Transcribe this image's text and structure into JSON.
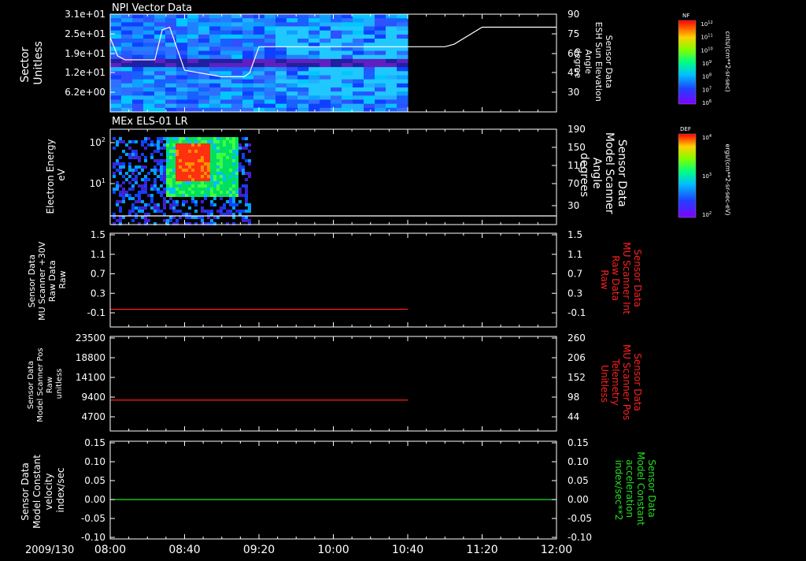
{
  "date_label": "2009/130",
  "time_ticks": [
    "08:00",
    "08:40",
    "09:20",
    "10:00",
    "10:40",
    "11:20",
    "12:00"
  ],
  "panels": [
    {
      "title": "NPI Vector Data",
      "left_label": [
        "Sector",
        "Unitless"
      ],
      "right_label": [
        "Sensor Data",
        "ESH Sun Elevation",
        "Angle",
        "degree"
      ],
      "left_ticks": [
        "3.1e+01",
        "2.5e+01",
        "1.9e+01",
        "1.2e+01",
        "6.2e+00"
      ],
      "right_ticks": [
        "90",
        "75",
        "60",
        "45",
        "30"
      ],
      "colorbar": {
        "label": "NF",
        "unit": "cnts/(cm**2-sr-sec)",
        "ticks": [
          "10^12",
          "10^11",
          "10^10",
          "10^9",
          "10^8",
          "10^7",
          "10^6"
        ]
      }
    },
    {
      "title": "MEx ELS-01 LR",
      "left_label": [
        "Electron Energy",
        "eV"
      ],
      "right_label": [
        "Sensor Data",
        "Model Scanner",
        "Angle",
        "degrees"
      ],
      "left_ticks": [
        "10^2",
        "10^1"
      ],
      "right_ticks": [
        "190",
        "150",
        "110",
        "70",
        "30"
      ],
      "colorbar": {
        "label": "DEF",
        "unit": "ergs/(cm**2-sr-sec-eV)",
        "ticks": [
          "10^4",
          "10^3",
          "10^2"
        ]
      }
    },
    {
      "left_label": [
        "Sensor Data",
        "MU Scanner +30V",
        "Raw Data",
        "Raw"
      ],
      "right_label": [
        "Sensor Data",
        "MU Scanner Int",
        "Raw Data",
        "Raw"
      ],
      "left_ticks": [
        "1.5",
        "1.1",
        "0.7",
        "0.3",
        "-0.1"
      ],
      "right_ticks": [
        "1.5",
        "1.1",
        "0.7",
        "0.3",
        "-0.1"
      ]
    },
    {
      "left_label": [
        "Sensor Data",
        "Model Scanner Pos",
        "Raw",
        "unitless"
      ],
      "right_label": [
        "Sensor Data",
        "MU Scanner Pos",
        "Telemetry",
        "Unitless"
      ],
      "left_ticks": [
        "23500",
        "18800",
        "14100",
        "9400",
        "4700"
      ],
      "right_ticks": [
        "260",
        "206",
        "152",
        "98",
        "44"
      ]
    },
    {
      "left_label": [
        "Sensor Data",
        "Model Constant",
        "velocity",
        "index/sec"
      ],
      "right_label": [
        "Sensor Data",
        "Model Constant",
        "acceleration",
        "index/sec**2"
      ],
      "left_ticks": [
        "0.15",
        "0.10",
        "0.05",
        "0.00",
        "-0.05",
        "-0.10"
      ],
      "right_ticks": [
        "0.15",
        "0.10",
        "0.05",
        "0.00",
        "-0.05",
        "-0.10"
      ]
    }
  ],
  "colors": {
    "red_trace": "#ff2020",
    "green_trace": "#20e020",
    "white": "#ffffff"
  },
  "chart_data": [
    {
      "type": "heatmap",
      "title": "NPI Vector Data",
      "ylabel": "Sector Unitless",
      "x_range": [
        "08:00",
        "12:00"
      ],
      "data_end": "10:40",
      "overlay_line": {
        "name": "Sensor Data ESH Sun Elevation Angle",
        "unit": "degree",
        "x": [
          "08:00",
          "08:04",
          "08:08",
          "08:24",
          "08:28",
          "08:32",
          "08:40",
          "09:00",
          "09:12",
          "09:15",
          "09:20",
          "10:00",
          "10:40",
          "11:00",
          "11:05",
          "11:20",
          "12:00"
        ],
        "y": [
          72,
          58,
          55,
          55,
          78,
          80,
          47,
          42,
          42,
          45,
          65,
          65,
          65,
          65,
          67,
          80,
          80
        ]
      }
    },
    {
      "type": "heatmap",
      "title": "MEx ELS-01 LR",
      "ylabel": "Electron Energy eV",
      "x_range": [
        "08:00",
        "12:00"
      ],
      "data_end": "09:15",
      "overlay_line": {
        "name": "Sensor Data Model Scanner Angle",
        "unit": "degrees",
        "x": [
          "08:00",
          "12:00"
        ],
        "y": [
          12,
          12
        ]
      }
    },
    {
      "type": "line",
      "series": [
        {
          "name": "Sensor Data MU Scanner Int Raw Data",
          "x": [
            "08:00",
            "10:40"
          ],
          "y": [
            0.0,
            0.0
          ]
        }
      ],
      "ylim": [
        -0.35,
        1.5
      ]
    },
    {
      "type": "line",
      "series": [
        {
          "name": "Sensor Data MU Scanner Pos Telemetry",
          "x": [
            "08:00",
            "10:40"
          ],
          "y": [
            85,
            85
          ]
        }
      ],
      "ylim": [
        0,
        260
      ]
    },
    {
      "type": "line",
      "series": [
        {
          "name": "Sensor Data Model Constant acceleration",
          "x": [
            "08:00",
            "12:00"
          ],
          "y": [
            0.0,
            0.0
          ]
        }
      ],
      "ylim": [
        -0.1,
        0.15
      ]
    }
  ]
}
